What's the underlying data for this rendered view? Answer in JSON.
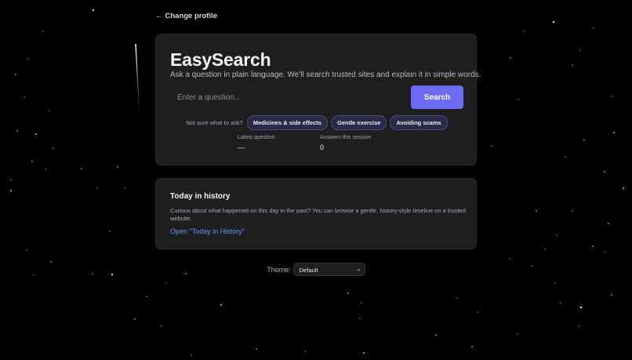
{
  "nav": {
    "back_arrow": "←",
    "back_label": "Change profile"
  },
  "search_card": {
    "title": "EasySearch",
    "subtitle": "Ask a question in plain language. We'll search trusted sites and explain it in simple words.",
    "search": {
      "placeholder": "Enter a question...",
      "value": "",
      "button_label": "Search"
    },
    "suggestions_label": "Not sure what to ask?",
    "suggestions": [
      "Medicines & side effects",
      "Gentle exercise",
      "Avoiding scams"
    ],
    "stats": [
      {
        "label": "Latest question",
        "value": "—"
      },
      {
        "label": "Answers this session",
        "value": "0"
      }
    ]
  },
  "history_card": {
    "heading": "Today in history",
    "description": "Curious about what happened on this day in the past? You can browse a gentle, history-style timeline on a trusted website.",
    "link_label": "Open \"Today in History\""
  },
  "theme": {
    "label": "Theme:",
    "selected": "Default",
    "chevron": "⌄"
  },
  "colors": {
    "background": "#000000",
    "card": "#1e1e20",
    "accent": "#6b6cf2",
    "link": "#5b9cf0",
    "chip": "#2a2a47"
  }
}
